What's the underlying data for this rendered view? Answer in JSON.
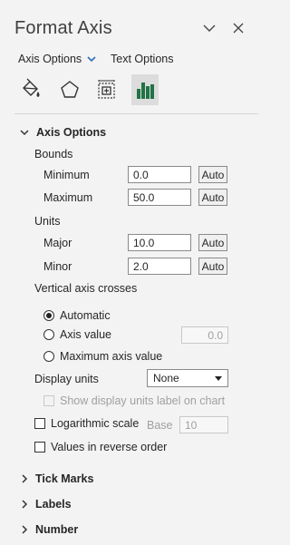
{
  "panel": {
    "title": "Format Axis"
  },
  "tabs": {
    "axis_options": "Axis Options",
    "text_options": "Text Options"
  },
  "icons": [
    "fill-line-icon",
    "effects-icon",
    "size-properties-icon",
    "axis-options-icon"
  ],
  "axis_options": {
    "heading": "Axis Options",
    "bounds_label": "Bounds",
    "minimum_label": "Minimum",
    "minimum_value": "0.0",
    "maximum_label": "Maximum",
    "maximum_value": "50.0",
    "auto_label": "Auto",
    "units_label": "Units",
    "major_label": "Major",
    "major_value": "10.0",
    "minor_label": "Minor",
    "minor_value": "2.0",
    "vertical_crosses_label": "Vertical axis crosses",
    "automatic_label": "Automatic",
    "axis_value_label": "Axis value",
    "axis_value_value": "0.0",
    "max_axis_value_label": "Maximum axis value",
    "display_units_label": "Display units",
    "display_units_value": "None",
    "show_units_label": "Show display units label on chart",
    "log_scale_label": "Logarithmic scale",
    "base_label": "Base",
    "base_value": "10",
    "reverse_label": "Values in reverse order"
  },
  "sections": {
    "tick_marks": "Tick Marks",
    "labels": "Labels",
    "number": "Number"
  }
}
